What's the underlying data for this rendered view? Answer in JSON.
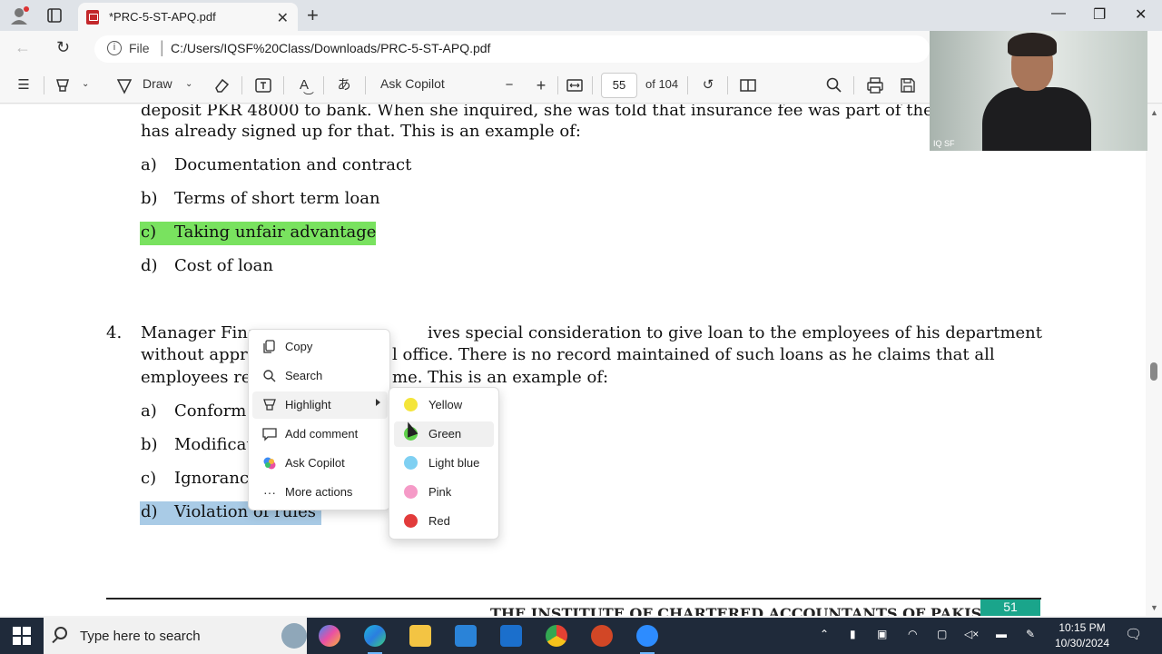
{
  "browser": {
    "tab_title": "*PRC-5-ST-APQ.pdf",
    "new_tab_label": "+",
    "url_scheme": "File",
    "url": "C:/Users/IQSF%20Class/Downloads/PRC-5-ST-APQ.pdf"
  },
  "pdf_toolbar": {
    "draw_label": "Draw",
    "ask_copilot_label": "Ask Copilot",
    "page_current": "55",
    "page_total_label": "of 104"
  },
  "document": {
    "q3_line1": "deposit PKR 48000 to bank. When she inquired, she was told that insurance fee was part of the pla",
    "q3_line2": "has already signed up for that. This is an example of:",
    "q3_options": [
      {
        "letter": "a)",
        "text": "Documentation and contract"
      },
      {
        "letter": "b)",
        "text": "Terms of short term loan"
      },
      {
        "letter": "c)",
        "text": "Taking unfair advantage"
      },
      {
        "letter": "d)",
        "text": "Cost of loan"
      }
    ],
    "q4_number": "4.",
    "q4_line1_start": "Manager Fina",
    "q4_line1_end": "ives special consideration to give loan to the employees of his department",
    "q4_line2_start": "without appr",
    "q4_line2_end": "l office. There is no record maintained of such loans as he claims that all",
    "q4_line3_start": "employees re",
    "q4_line3_end": "me. This is an example of:",
    "q4_options": [
      {
        "letter": "a)",
        "text": "Conform"
      },
      {
        "letter": "b)",
        "text": "Modificat"
      },
      {
        "letter": "c)",
        "text": "Ignoranc"
      },
      {
        "letter": "d)",
        "text": "Violation of rules"
      }
    ],
    "footer_text": "THE INSTITUTE OF CHARTERED ACCOUNTANTS OF PAKISTAN",
    "footer_page": "51"
  },
  "video_overlay": {
    "participant_name": "IQ SF"
  },
  "context_menu": {
    "items": [
      {
        "label": "Copy",
        "icon": "copy-icon"
      },
      {
        "label": "Search",
        "icon": "search-icon"
      },
      {
        "label": "Highlight",
        "icon": "highlighter-icon"
      },
      {
        "label": "Add comment",
        "icon": "comment-icon"
      },
      {
        "label": "Ask Copilot",
        "icon": "copilot-icon"
      },
      {
        "label": "More actions",
        "icon": "ellipsis-icon"
      }
    ],
    "highlight_submenu": [
      {
        "label": "Yellow",
        "color": "#f4e53a"
      },
      {
        "label": "Green",
        "color": "#5fd14a"
      },
      {
        "label": "Light blue",
        "color": "#7fd0f2"
      },
      {
        "label": "Pink",
        "color": "#f59ac7"
      },
      {
        "label": "Red",
        "color": "#e23b3b"
      }
    ]
  },
  "taskbar": {
    "search_placeholder": "Type here to search",
    "time": "10:15 PM",
    "date": "10/30/2024"
  },
  "colors": {
    "highlight_green": "#79e25f",
    "highlight_blue": "#a9cbe6",
    "footer_accent": "#1aa58b"
  }
}
